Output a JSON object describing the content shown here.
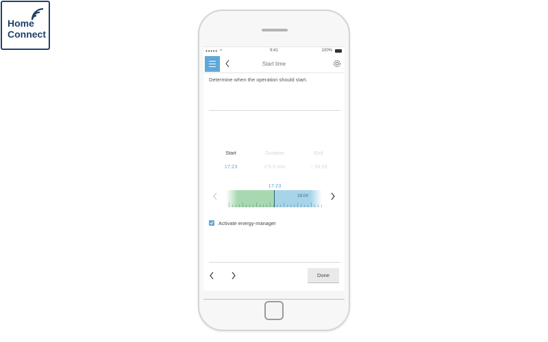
{
  "logo": {
    "line1": "Home",
    "line2": "Connect"
  },
  "status_bar": {
    "time": "9:41",
    "battery": "100%"
  },
  "nav": {
    "title": "Start time"
  },
  "instruction": "Determine when the operation should start.",
  "columns": [
    {
      "label": "Start",
      "value": "17:23"
    },
    {
      "label": "Duration",
      "value": "2 h 0 min"
    },
    {
      "label": "End",
      "value": "~ 19:23"
    }
  ],
  "timeline": {
    "current": "17:23",
    "tick_label": "18:00"
  },
  "energy_manager": {
    "label": "Activate energy-manager",
    "checked": true
  },
  "footer": {
    "done_label": "Done"
  },
  "colors": {
    "accent": "#5fa8d8",
    "green_zone": "#a8d8b0",
    "blue_zone": "#a8d4ea",
    "logo": "#1d3f6b"
  }
}
